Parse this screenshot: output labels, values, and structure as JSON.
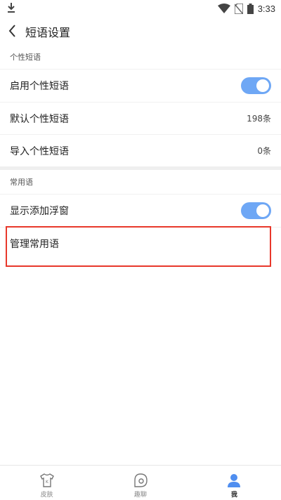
{
  "status_bar": {
    "time": "3:33"
  },
  "header": {
    "title": "短语设置"
  },
  "sections": [
    {
      "title": "个性短语",
      "rows": [
        {
          "label": "启用个性短语",
          "toggle_on": true
        },
        {
          "label": "默认个性短语",
          "value": "198条"
        },
        {
          "label": "导入个性短语",
          "value": "0条"
        }
      ]
    },
    {
      "title": "常用语",
      "rows": [
        {
          "label": "显示添加浮窗",
          "toggle_on": true
        },
        {
          "label": "管理常用语"
        }
      ]
    }
  ],
  "tabs": [
    {
      "label": "皮肤",
      "icon": "shirt-icon"
    },
    {
      "label": "趣聊",
      "icon": "chat-icon"
    },
    {
      "label": "我",
      "icon": "profile-icon",
      "active": true
    }
  ],
  "colors": {
    "toggle_on": "#6ea7f5",
    "highlight_border": "#e8382b",
    "tab_active": "#4f8ef0"
  }
}
